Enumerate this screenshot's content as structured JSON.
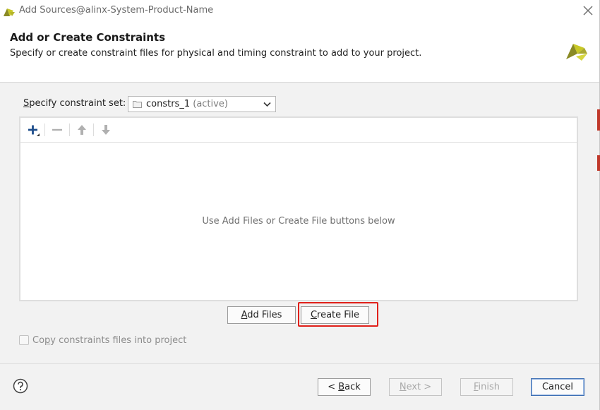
{
  "window": {
    "title": "Add Sources@alinx-System-Product-Name"
  },
  "header": {
    "title": "Add or Create Constraints",
    "subtitle": "Specify or create constraint files for physical and timing constraint to add to your project."
  },
  "constraint_set": {
    "label_first": "S",
    "label_rest": "pecify constraint set:",
    "value": "constrs_1",
    "status": "(active)"
  },
  "toolbar": {
    "add_icon": "plus-icon",
    "remove_icon": "minus-icon",
    "up_icon": "arrow-up-icon",
    "down_icon": "arrow-down-icon"
  },
  "file_list": {
    "empty_message": "Use Add Files or Create File buttons below"
  },
  "buttons": {
    "add_files_u": "A",
    "add_files_rest": "dd Files",
    "create_file_u": "C",
    "create_file_rest": "reate File",
    "back_pre": "< ",
    "back_u": "B",
    "back_rest": "ack",
    "next_u": "N",
    "next_rest": "ext >",
    "finish_u": "F",
    "finish_rest": "inish",
    "cancel": "Cancel"
  },
  "copy_option": {
    "label_pre": "Co",
    "label_u": "p",
    "label_rest": "y constraints files into project",
    "checked": false,
    "enabled": false
  },
  "colors": {
    "highlight": "#e0201a",
    "accent_blue": "#3d6fb4",
    "brand_yellow": "#c8c825",
    "brand_olive": "#8a8a24"
  }
}
